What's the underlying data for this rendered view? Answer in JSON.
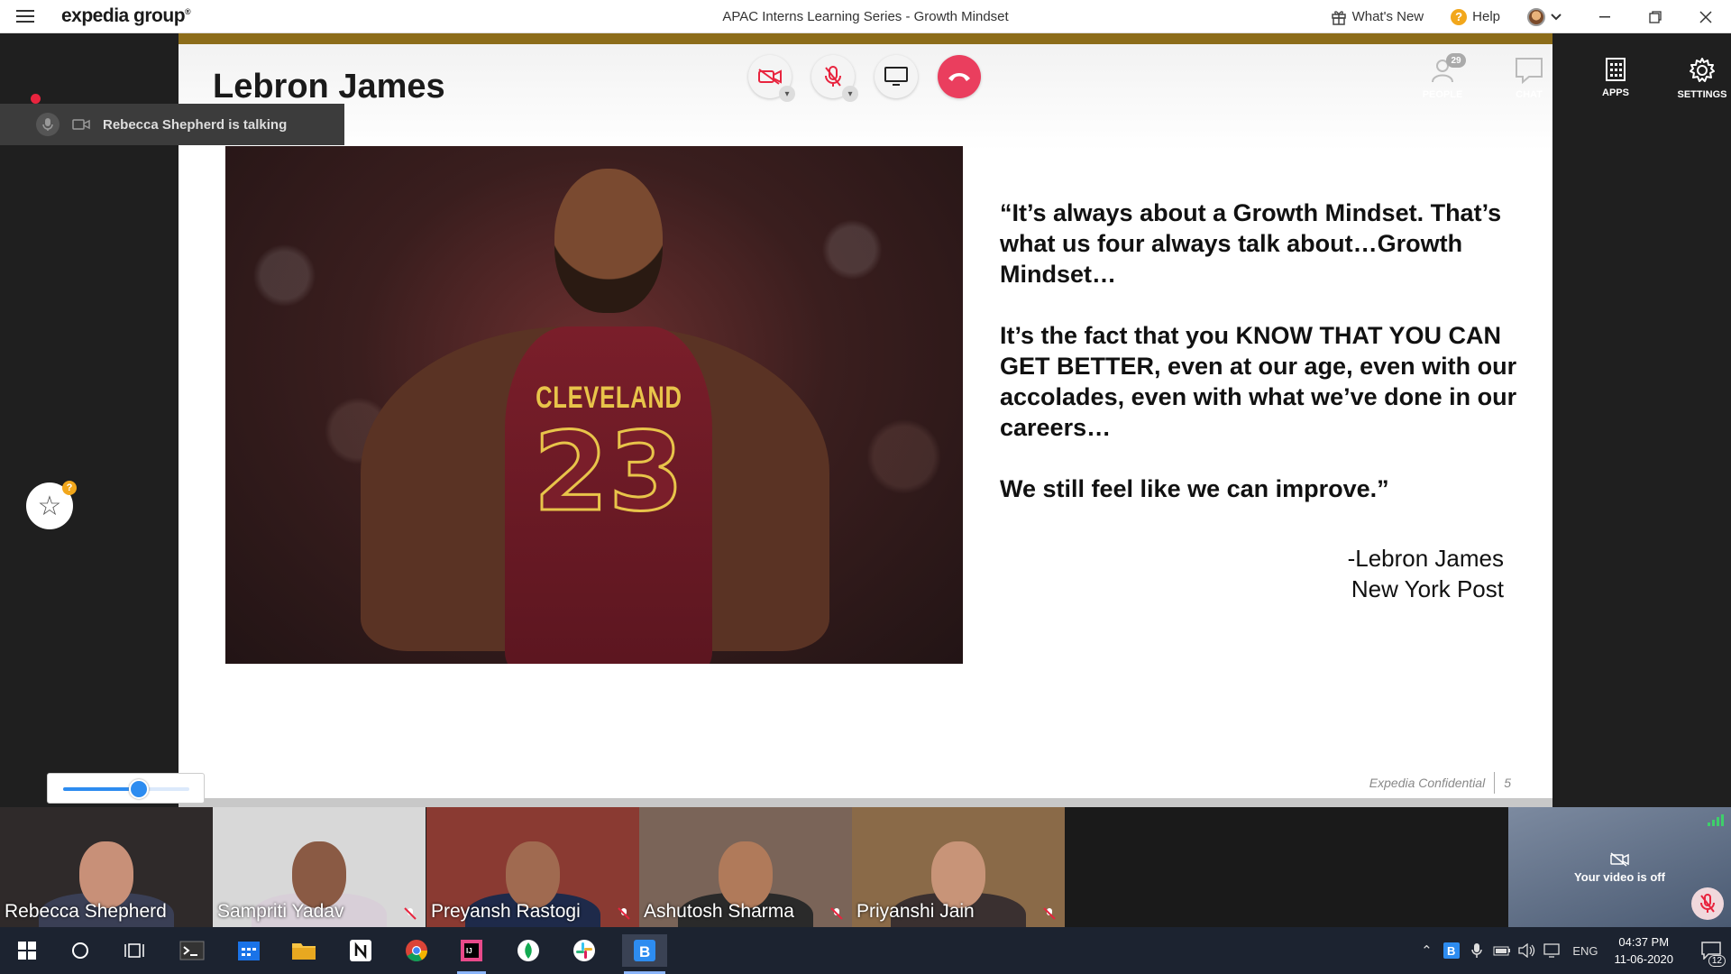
{
  "titlebar": {
    "brand": "expedia group",
    "brand_mark": "®",
    "title": "APAC Interns Learning Series - Growth Mindset",
    "whats_new": "What's New",
    "help": "Help",
    "help_glyph": "?"
  },
  "talking": "Rebecca Shepherd is talking",
  "controls": {
    "people_label": "PEOPLE",
    "people_count": "29",
    "chat_label": "CHAT",
    "apps_label": "APPS",
    "settings_label": "SETTINGS"
  },
  "star_badge": "?",
  "slider": {
    "value": 0.6
  },
  "slide": {
    "title": "Lebron James",
    "jersey_text": "CLEVELAND",
    "jersey_number": "23",
    "quote_p1": "“It’s always about a Growth Mindset. That’s what us four always talk about…Growth Mindset…",
    "quote_p2": "It’s the fact that you KNOW THAT YOU CAN GET BETTER, even at our age, even with our accolades, even with what we’ve done in our careers…",
    "quote_p3": "We still feel like we can improve.”",
    "attribution_1": "-Lebron James",
    "attribution_2": "New York Post",
    "footer": "Expedia Confidential",
    "page_number": "5"
  },
  "participants": [
    {
      "name": "Rebecca Shepherd",
      "bg": "#2f2a2a",
      "face": "#c89078",
      "body": "#3a3f55"
    },
    {
      "name": "Sampriti Yadav",
      "bg": "#d8d8d8",
      "face": "#8a5a44",
      "body": "#d8cfd8"
    },
    {
      "name": "Preyansh Rastogi",
      "bg": "#8a3a32",
      "face": "#a06a50",
      "body": "#1e2a4a"
    },
    {
      "name": "Ashutosh Sharma",
      "bg": "#7a6458",
      "face": "#b07a5a",
      "body": "#2a2a2a"
    },
    {
      "name": "Priyanshi Jain",
      "bg": "#8a6a48",
      "face": "#c89478",
      "body": "#3a3030"
    }
  ],
  "self_view": "Your video is off",
  "tray": {
    "lang": "ENG",
    "time": "04:37 PM",
    "date": "11-06-2020",
    "notifications": "12"
  },
  "colors": {
    "end_call": "#ea3e5e",
    "accent": "#2d8cf0",
    "mute_red": "#e8243e",
    "slide_bar": "#8c6c1a"
  }
}
